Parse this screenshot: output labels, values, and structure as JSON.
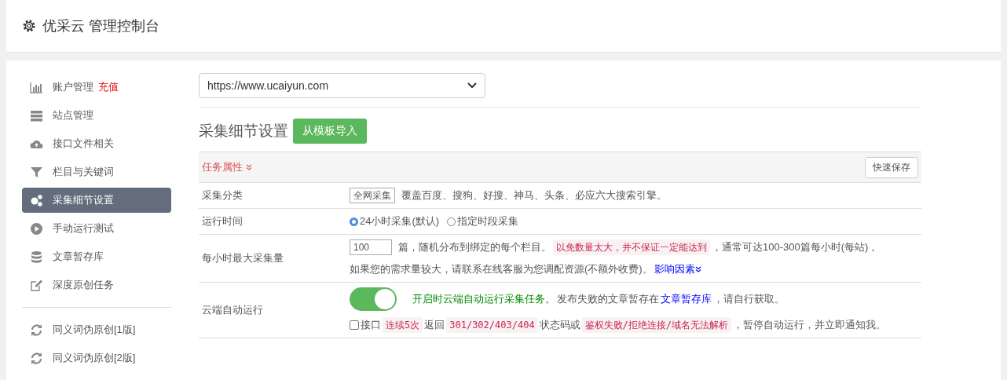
{
  "header": {
    "title": "优采云 管理控制台"
  },
  "sidebar": {
    "groups": [
      [
        {
          "label": "账户管理",
          "badge": "充值",
          "selected": false
        },
        {
          "label": "站点管理",
          "selected": false
        },
        {
          "label": "接口文件相关",
          "selected": false
        },
        {
          "label": "栏目与关键词",
          "selected": false
        },
        {
          "label": "采集细节设置",
          "selected": true
        },
        {
          "label": "手动运行测试",
          "selected": false
        },
        {
          "label": "文章暂存库",
          "selected": false
        },
        {
          "label": "深度原创任务",
          "selected": false
        }
      ],
      [
        {
          "label": "同义词伪原创[1版]",
          "selected": false
        },
        {
          "label": "同义词伪原创[2版]",
          "selected": false
        }
      ]
    ]
  },
  "site_select": {
    "value": "https://www.ucaiyun.com"
  },
  "section": {
    "title": "采集细节设置",
    "import_button": "从模板导入"
  },
  "panel": {
    "header_link": "任务属性",
    "save_button": "快速保存",
    "rows": [
      {
        "kind": "select",
        "label": "采集分类",
        "value": "全网采集",
        "lines": [
          [
            {
              "kind": "text",
              "text": "覆盖百度、搜狗、好搜、神马、头条、必应六大搜索引擎。"
            }
          ]
        ]
      },
      {
        "kind": "radios",
        "label": "运行时间",
        "options": [
          {
            "label": "24小时采集(默认)",
            "selected": true
          },
          {
            "label": "指定时段采集",
            "selected": false
          }
        ]
      },
      {
        "kind": "number",
        "label": "每小时最大采集量",
        "value": "100",
        "lines": [
          [
            {
              "kind": "text",
              "text": "篇，随机分布到绑定的每个栏目。"
            },
            {
              "kind": "code",
              "text": "以免数量太大，并不保证一定能达到"
            },
            {
              "kind": "text",
              "text": "，通常可达100-300篇每小时(每站)，"
            }
          ],
          [
            {
              "kind": "text",
              "text": "如果您的需求量较大，请联系在线客服为您调配资源(不额外收费)。"
            },
            {
              "kind": "more",
              "text": "影响因素"
            }
          ]
        ]
      },
      {
        "kind": "toggle",
        "label": "云端自动运行",
        "on": true,
        "lines": [
          [
            {
              "kind": "green",
              "text": "开启时云端自动运行采集任务。"
            },
            {
              "kind": "text",
              "text": "发布失败的文章暂存在"
            },
            {
              "kind": "link",
              "text": "文章暂存库"
            },
            {
              "kind": "text",
              "text": "，请自行获取。"
            }
          ],
          [
            {
              "kind": "checkbox",
              "checked": false
            },
            {
              "kind": "text",
              "text": "接口"
            },
            {
              "kind": "code",
              "text": "连续5次"
            },
            {
              "kind": "text",
              "text": "返回"
            },
            {
              "kind": "code",
              "text": "301/302/403/404"
            },
            {
              "kind": "text",
              "text": "状态码或"
            },
            {
              "kind": "code",
              "text": "鉴权失败/拒绝连接/域名无法解析"
            },
            {
              "kind": "text",
              "text": "，暂停自动运行，并立即通知我。"
            }
          ]
        ]
      }
    ]
  }
}
